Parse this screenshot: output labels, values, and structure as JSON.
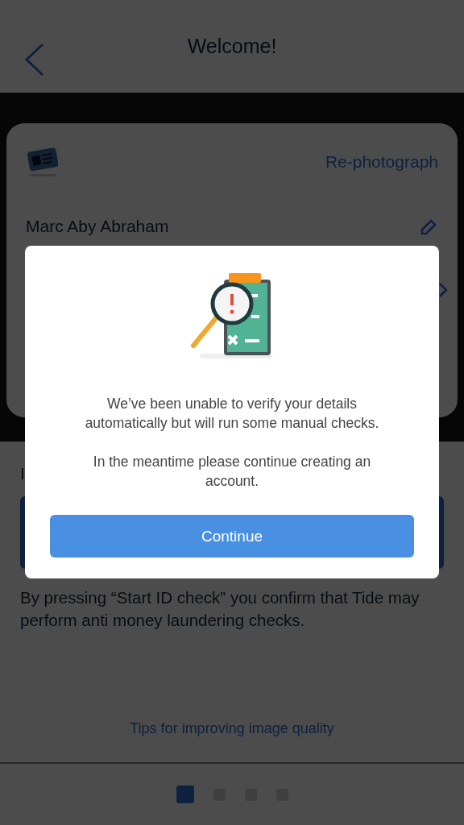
{
  "header": {
    "title": "Welcome!"
  },
  "id_card": {
    "action": "Re-photograph",
    "name": "Marc Aby Abraham"
  },
  "intro_text": "I",
  "consent_text": "By pressing “Start ID check” you confirm that Tide may perform anti money laundering checks.",
  "tips_link": "Tips for improving image quality",
  "pager": [
    {
      "selected": true
    },
    {
      "selected": false
    },
    {
      "selected": false
    },
    {
      "selected": false
    }
  ],
  "dialog": {
    "message": "We’ve been unable to verify your details automatically but will run some manual checks.",
    "note": "In the meantime please continue creating an account.",
    "button": "Continue"
  }
}
